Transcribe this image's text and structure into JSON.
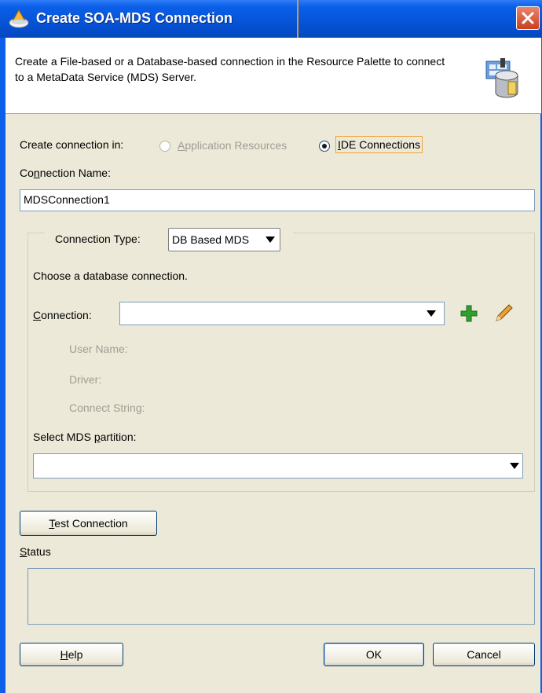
{
  "window": {
    "title": "Create SOA-MDS Connection",
    "description": "Create a File-based or a Database-based connection in the Resource Palette to connect to a MetaData Service (MDS) Server."
  },
  "create_in": {
    "label": "Create connection in:",
    "option_app": "Application Resources",
    "option_ide": "IDE Connections",
    "selected": "IDE Connections"
  },
  "connection_name": {
    "label": "Connection Name:",
    "value": "MDSConnection1"
  },
  "connection_type": {
    "label": "Connection Type:",
    "value": "DB Based MDS"
  },
  "db": {
    "choose_text": "Choose a database connection.",
    "connection_label": "Connection:",
    "connection_value": "",
    "user_name_label": "User Name:",
    "driver_label": "Driver:",
    "connect_string_label": "Connect String:",
    "partition_label": "Select MDS partition:",
    "partition_value": ""
  },
  "buttons": {
    "test_connection": "Test Connection",
    "help": "Help",
    "ok": "OK",
    "cancel": "Cancel"
  },
  "status": {
    "label": "Status",
    "text": ""
  },
  "icons": {
    "app_icon": "jdeveloper-icon",
    "header_icon": "mds-database-icon",
    "close": "close-icon",
    "add": "plus-icon",
    "edit": "pencil-icon"
  },
  "colors": {
    "titlebar": "#0653d6",
    "focus": "#f0a33c",
    "add_green": "#2ea02e"
  }
}
